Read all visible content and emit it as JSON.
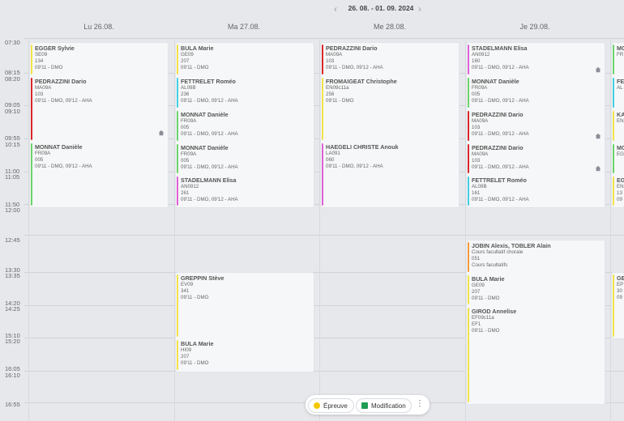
{
  "nav": {
    "prev_icon": "chevron-left",
    "next_icon": "chevron-right",
    "week": "26. 08. - 01. 09. 2024"
  },
  "days": [
    "Lu 26.08.",
    "Ma 27.08.",
    "Me 28.08.",
    "Je 29.08."
  ],
  "times": [
    "07:30",
    "08:15",
    "08:20",
    "09:05",
    "09:10",
    "09:55",
    "10:15",
    "11:00",
    "11:05",
    "11:50",
    "12:00",
    "12:45",
    "13:30",
    "13:35",
    "14:20",
    "14:25",
    "15:10",
    "15:20",
    "16:05",
    "16:10",
    "16:55"
  ],
  "colors": {
    "yellow": "#f2e24a",
    "red": "#d9262b",
    "green": "#6cd36b",
    "cyan": "#43cfe0",
    "magenta": "#e05fd6",
    "orange": "#f29a3a",
    "legend_green": "#1f9d55"
  },
  "lessons": {
    "mon": [
      {
        "name": "EGGER Sylvie",
        "l1": "SE09",
        "l2": "134",
        "l3": "09'11 - DMO"
      },
      {
        "name": "PEDRAZZINI Dario",
        "l1": "MA09A",
        "l2": "103",
        "l3": "09'11 - DMO, 09'12 - AHA"
      },
      {
        "name": "MONNAT Danièle",
        "l1": "FR09A",
        "l2": "005",
        "l3": "09'11 - DMO, 09'12 - AHA"
      }
    ],
    "tue": [
      {
        "name": "BULA Marie",
        "l1": "GE09",
        "l2": "207",
        "l3": "09'11 - DMO"
      },
      {
        "name": "FETTRELET Roméo",
        "l1": "AL09B",
        "l2": "236",
        "l3": "09'11 - DMO, 09'12 - AHA"
      },
      {
        "name": "MONNAT Danièle",
        "l1": "FR09A",
        "l2": "005",
        "l3": "09'11 - DMO, 09'12 - AHA"
      },
      {
        "name": "MONNAT Danièle",
        "l1": "FR09A",
        "l2": "005",
        "l3": "09'11 - DMO, 09'12 - AHA"
      },
      {
        "name": "STADELMANN Elisa",
        "l1": "AN0912",
        "l2": "261",
        "l3": "09'11 - DMO, 09'12 - AHA"
      },
      {
        "name": "GREPPIN Stève",
        "l1": "EV09",
        "l2": "341",
        "l3": "09'11 - DMO"
      },
      {
        "name": "BULA Marie",
        "l1": "HI09",
        "l2": "207",
        "l3": "09'11 - DMO"
      }
    ],
    "wed": [
      {
        "name": "PEDRAZZINI Dario",
        "l1": "MA09A",
        "l2": "103",
        "l3": "09'11 - DMO, 09'12 - AHA"
      },
      {
        "name": "FROMAIGEAT Christophe",
        "l1": "EN09c11a",
        "l2": "256",
        "l3": "09'11 - DMO"
      },
      {
        "name": "HAEGELI CHRISTE Anouk",
        "l1": "LA091",
        "l2": "060",
        "l3": "09'11 - DMO, 09'12 - AHA"
      }
    ],
    "thu": [
      {
        "name": "STADELMANN Elisa",
        "l1": "AN0912",
        "l2": "160",
        "l3": "09'11 - DMO, 09'12 - AHA"
      },
      {
        "name": "MONNAT Danièle",
        "l1": "FR09A",
        "l2": "005",
        "l3": "09'11 - DMO, 09'12 - AHA"
      },
      {
        "name": "PEDRAZZINI Dario",
        "l1": "MA09A",
        "l2": "103",
        "l3": "09'11 - DMO, 09'12 - AHA"
      },
      {
        "name": "PEDRAZZINI Dario",
        "l1": "MA09A",
        "l2": "103",
        "l3": "09'11 - DMO, 09'12 - AHA"
      },
      {
        "name": "FETTRELET Roméo",
        "l1": "AL09B",
        "l2": "161",
        "l3": "09'11 - DMO, 09'12 - AHA"
      },
      {
        "name": "JOBIN Alexis, TOBLER Alain",
        "l1": "Cours facultatif chorale",
        "l2": "051",
        "l3": "Cours facultatifs"
      },
      {
        "name": "BULA Marie",
        "l1": "GE09",
        "l2": "207",
        "l3": "09'11 - DMO"
      },
      {
        "name": "GIROD Annelise",
        "l1": "EF09c11a",
        "l2": "EF1",
        "l3": "09'11 - DMO"
      }
    ],
    "fri_partial": [
      {
        "name": "MO",
        "l1": "FR"
      },
      {
        "name": "FE",
        "l1": "AL"
      },
      {
        "name": "KA",
        "l1": "EN"
      },
      {
        "name": "MO",
        "l1": "EG"
      },
      {
        "name": "EG",
        "l1": "EN",
        "l2": "13",
        "l3": "09"
      },
      {
        "name": "GE",
        "l1": "EP",
        "l2": "30",
        "l3": "09"
      }
    ]
  },
  "legend": {
    "exam": "Épreuve",
    "modification": "Modification",
    "menu_icon": "more-vertical-icon"
  }
}
